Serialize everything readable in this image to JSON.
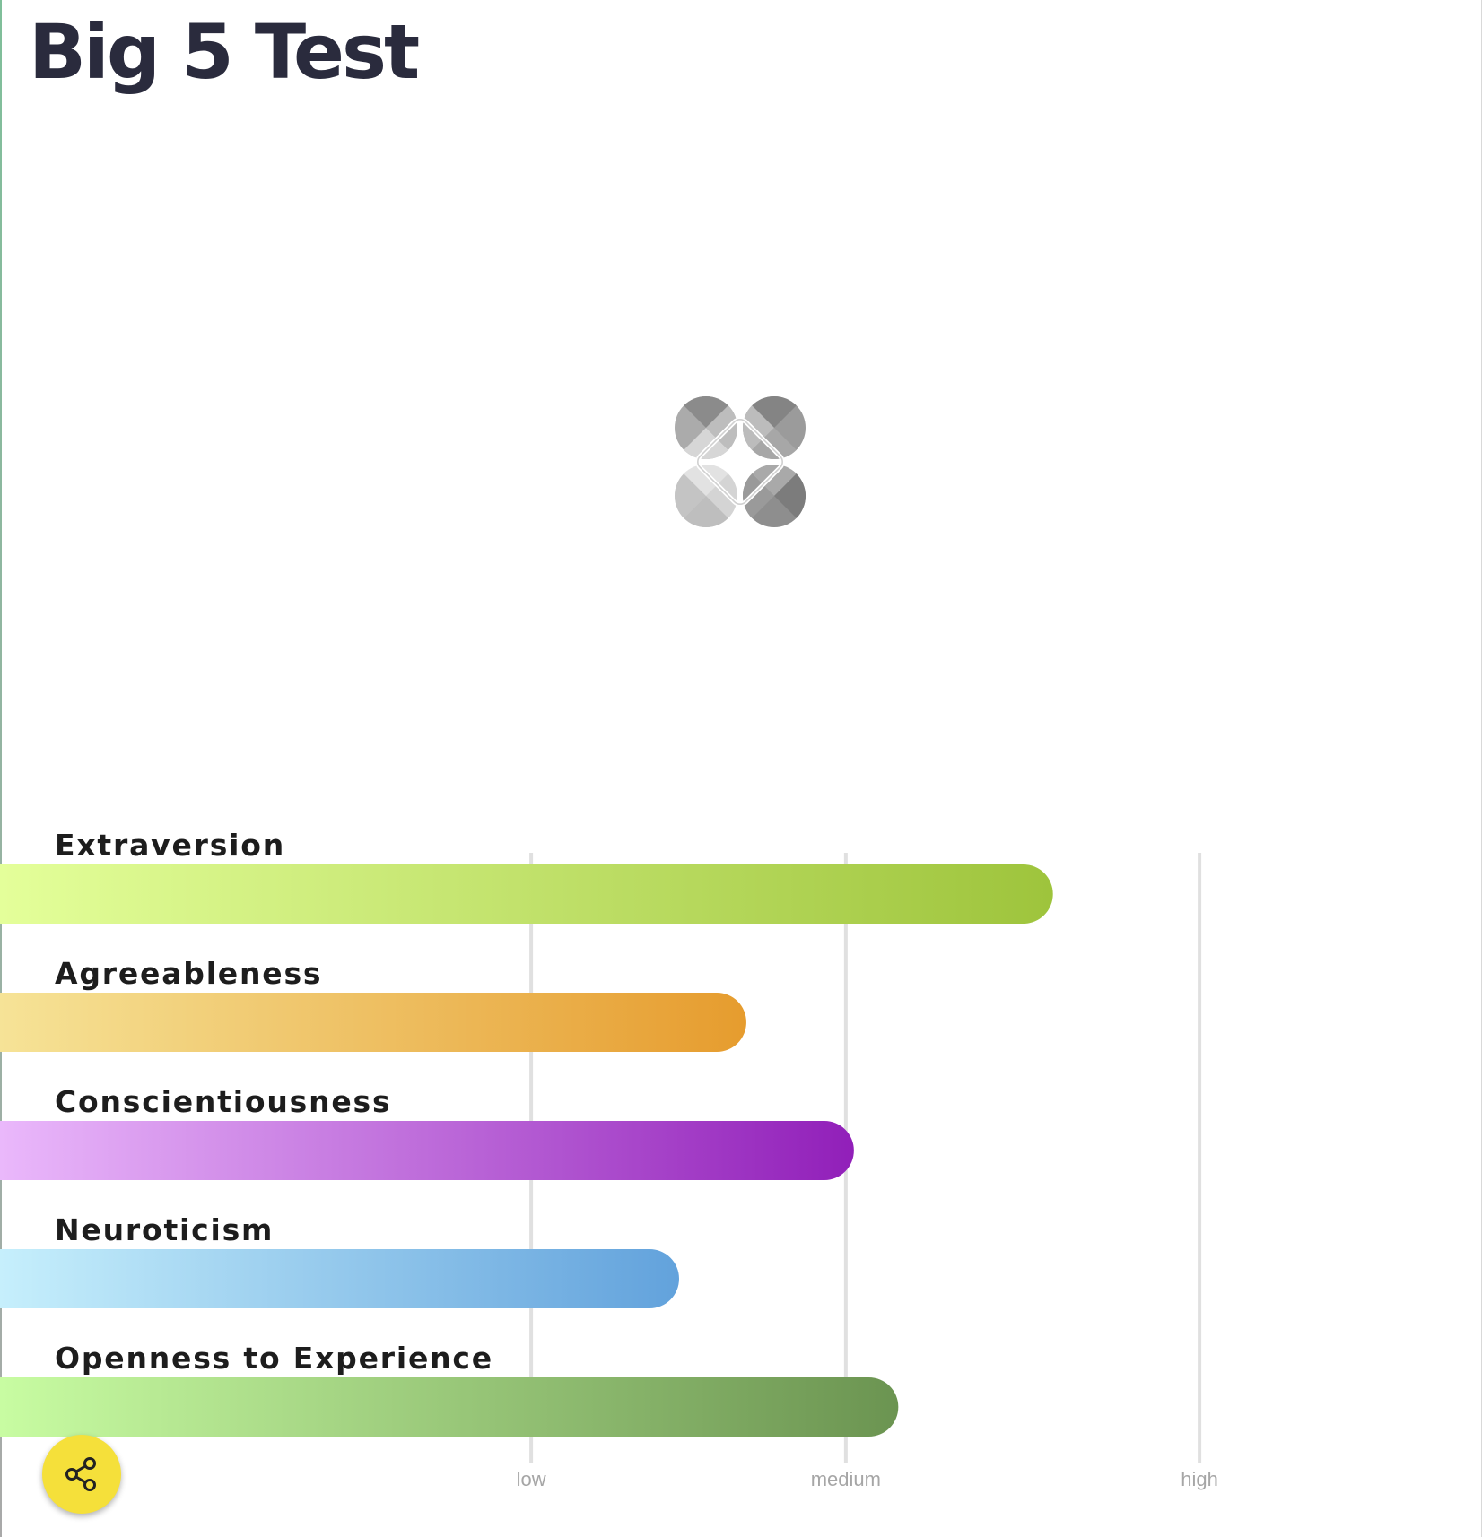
{
  "header": {
    "title": "Big 5 Test"
  },
  "share": {
    "icon": "share-icon",
    "color": "#f5e03a"
  },
  "loader": {
    "icon": "loading-spinner-icon"
  },
  "chart_data": {
    "type": "bar",
    "orientation": "horizontal",
    "categories": [
      "Extraversion",
      "Agreeableness",
      "Conscientiousness",
      "Neuroticism",
      "Openness to Experience"
    ],
    "values": [
      0.783,
      0.555,
      0.635,
      0.505,
      0.668
    ],
    "xlim": [
      0,
      1
    ],
    "ticks": [
      {
        "label": "low",
        "value": 0.395
      },
      {
        "label": "medium",
        "value": 0.629
      },
      {
        "label": "high",
        "value": 0.892
      }
    ],
    "grid": true,
    "legend": "none",
    "colors": [
      [
        "#e4ff9a",
        "#9ec43c"
      ],
      [
        "#f6e397",
        "#e69c2e"
      ],
      [
        "#eab8fb",
        "#911fb9"
      ],
      [
        "#c6effc",
        "#62a2dc"
      ],
      [
        "#c8fca2",
        "#6b9451"
      ]
    ]
  }
}
